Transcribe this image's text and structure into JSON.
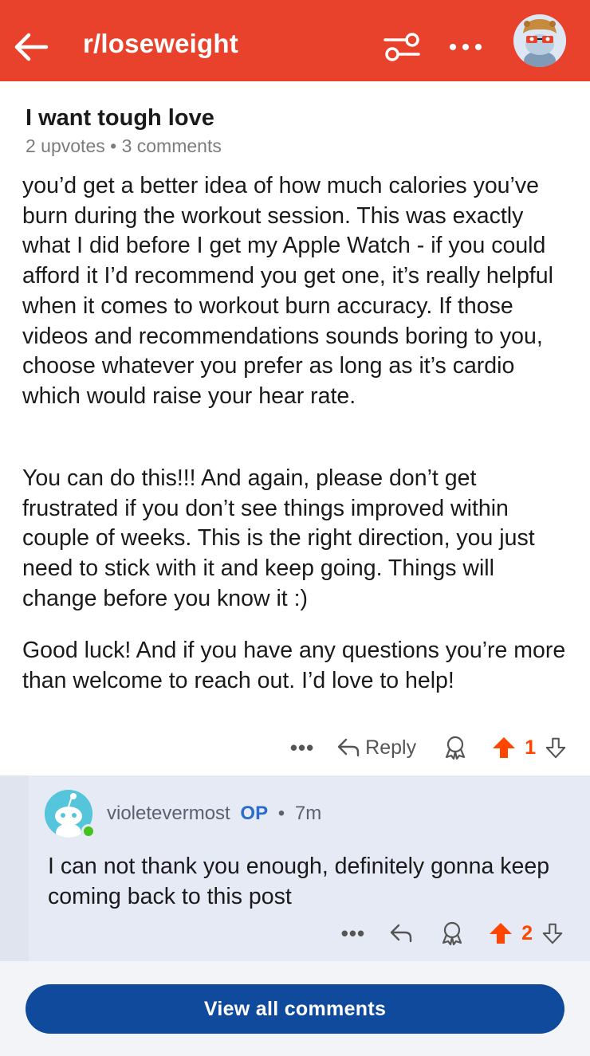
{
  "header": {
    "subreddit": "r/loseweight",
    "back_icon": "back-arrow-icon",
    "filter_icon": "filter-sliders-icon",
    "more_icon": "more-dots-icon",
    "avatar_icon": "user-avatar"
  },
  "post": {
    "title": "I want tough love",
    "meta": "2 upvotes • 3 comments"
  },
  "comment": {
    "paragraphs": [
      "you’d get a better idea of how much calories you’ve burn during the workout session. This was exactly what I did before I get my Apple Watch - if you could afford it I’d recommend you get one, it’s really helpful when it comes to workout burn accuracy. If those videos and recommendations sounds boring to you, choose whatever you prefer as long as it’s cardio which would raise your hear rate.",
      "You can do this!!! And again, please don’t get frustrated if you don’t see things improved within couple of weeks. This is the right direction, you just need to stick with it and keep going. Things will change before you know it :)",
      "Good luck! And if you have any questions you’re more than welcome to reach out. I’d love to help!"
    ],
    "actions": {
      "more": "•••",
      "reply_label": "Reply",
      "vote_count": "1"
    }
  },
  "reply": {
    "author": "violetevermost",
    "op_badge": "OP",
    "separator": "•",
    "time": "7m",
    "text": "I can not thank you enough, definitely gonna keep coming back to this post",
    "actions": {
      "more": "•••",
      "vote_count": "2"
    }
  },
  "footer": {
    "view_all_label": "View all comments"
  },
  "colors": {
    "brand": "#e8422c",
    "upvote": "#ff4500",
    "op_badge": "#2c6bcb",
    "button": "#0f4a9c",
    "online": "#46c21e"
  }
}
